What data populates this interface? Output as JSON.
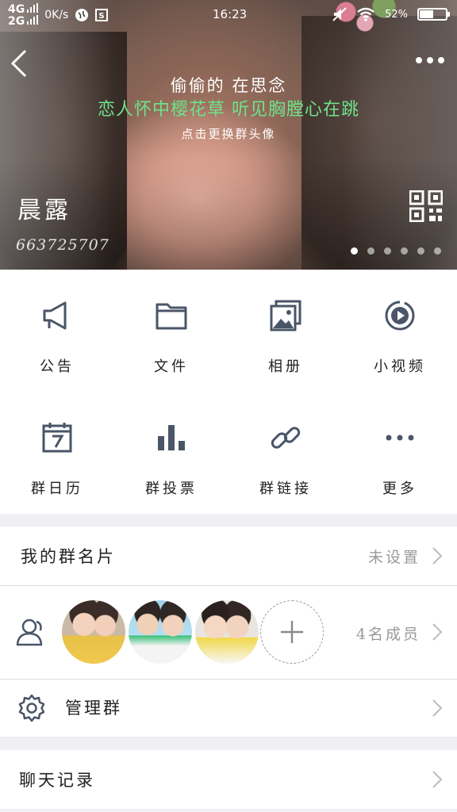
{
  "status_bar": {
    "network_top": "4G",
    "network_bottom": "2G",
    "speed": "0K/s",
    "time": "16:23",
    "battery": "52%",
    "battery_level": 0.52
  },
  "banner": {
    "line1": "偷偷的 在思念",
    "line2": "恋人怀中樱花草 听见胸膛心在跳",
    "line3": "点击更换群头像",
    "group_name": "晨露",
    "group_id": "663725707",
    "pages": 6,
    "active_page": 0,
    "accent_text_color": "#6fe38a"
  },
  "actions": [
    {
      "label": "公告",
      "icon": "megaphone-icon"
    },
    {
      "label": "文件",
      "icon": "folder-icon"
    },
    {
      "label": "相册",
      "icon": "album-icon"
    },
    {
      "label": "小视频",
      "icon": "video-play-icon"
    },
    {
      "label": "群日历",
      "icon": "calendar-icon"
    },
    {
      "label": "群投票",
      "icon": "bar-chart-icon"
    },
    {
      "label": "群链接",
      "icon": "link-icon"
    },
    {
      "label": "更多",
      "icon": "more-dots-icon"
    }
  ],
  "rows": {
    "card": {
      "label": "我的群名片",
      "value": "未设置"
    },
    "members": {
      "value": "4名成员"
    },
    "manage": {
      "label": "管理群"
    },
    "history": {
      "label": "聊天记录"
    }
  },
  "colors": {
    "icon": "#4a5568",
    "secondary_text": "#999999"
  }
}
